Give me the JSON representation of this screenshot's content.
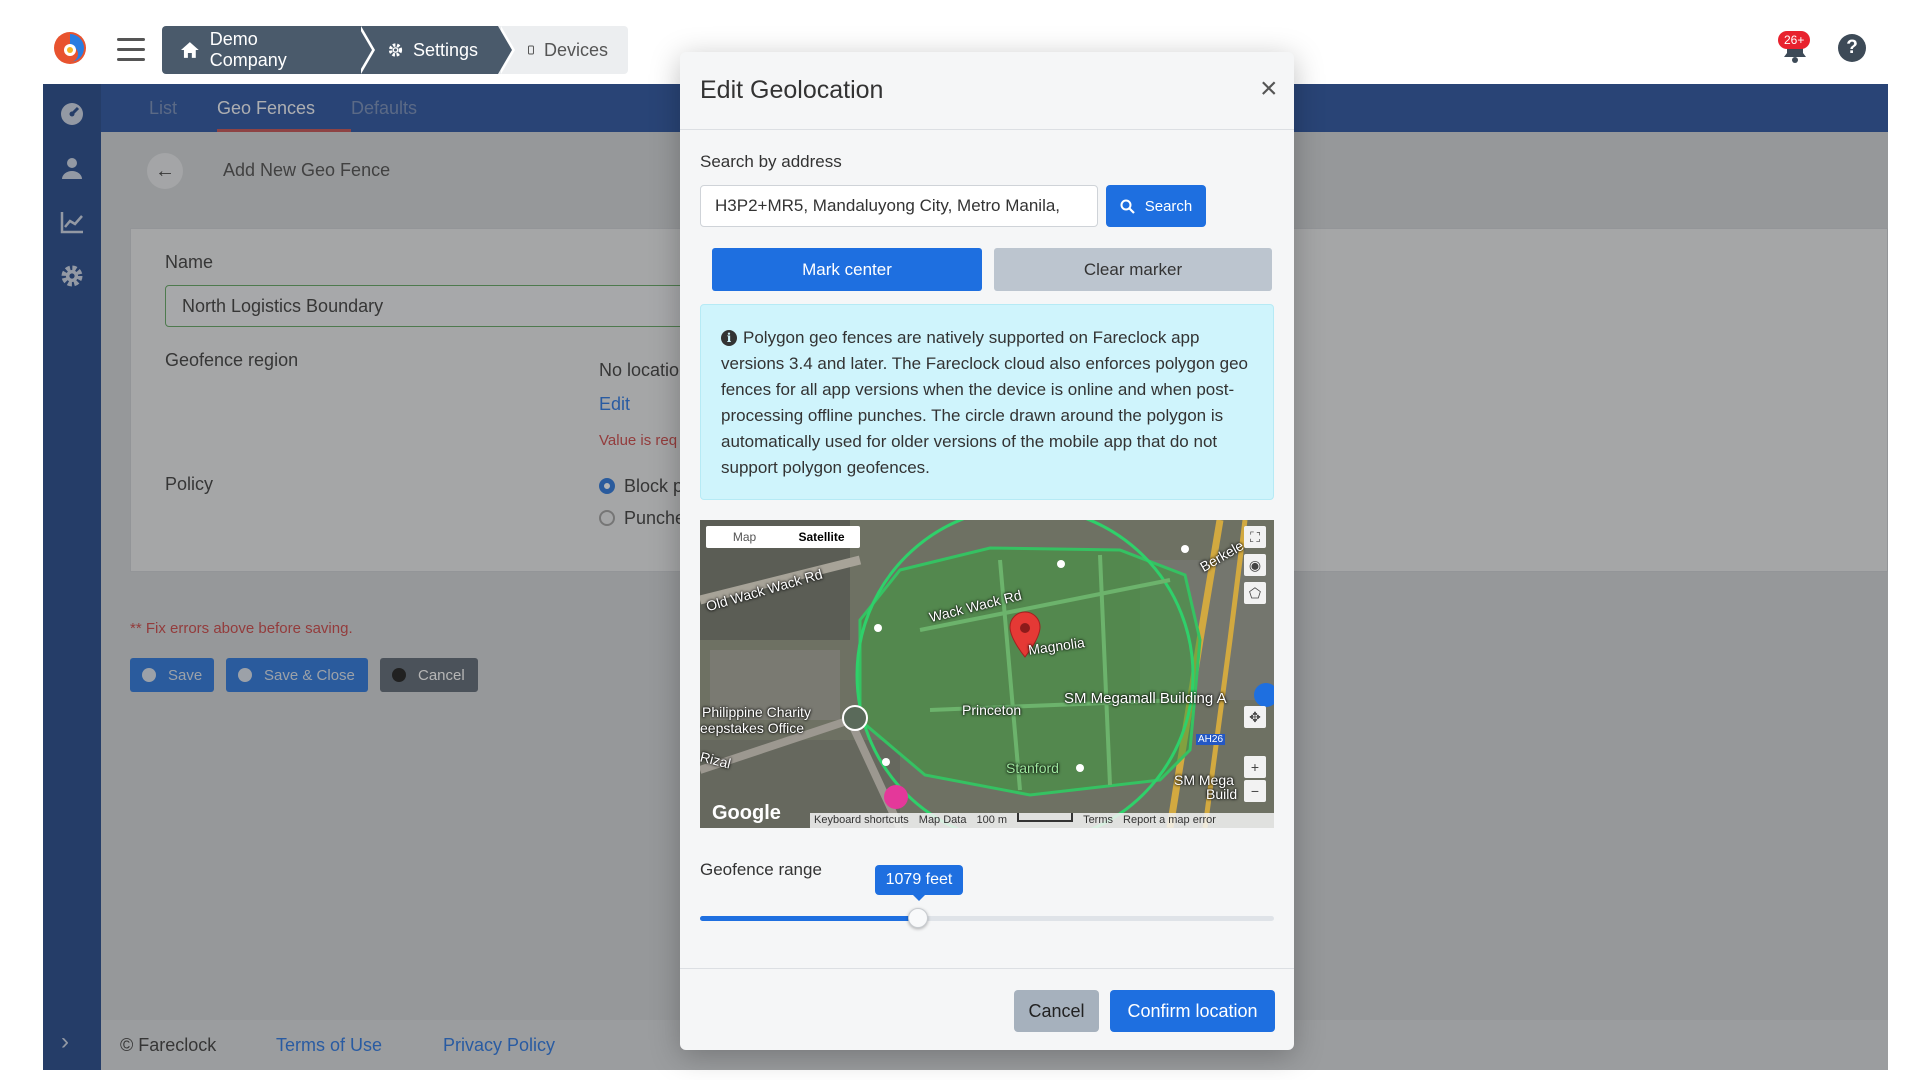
{
  "header": {
    "breadcrumbs": [
      "Demo Company",
      "Settings",
      "Devices"
    ],
    "notification_count": "26+",
    "help_label": "?"
  },
  "nav": {
    "tabs": [
      "List",
      "Geo Fences",
      "Defaults"
    ],
    "active_tab": "Geo Fences"
  },
  "page": {
    "title": "Add New Geo Fence",
    "name_label": "Name",
    "name_value": "North Logistics Boundary",
    "region_label": "Geofence region",
    "region_value": "No locatio",
    "region_edit": "Edit",
    "region_error": "Value is req",
    "policy_label": "Policy",
    "policy_options": [
      "Block p",
      "Punche"
    ],
    "form_error": "** Fix errors above before saving.",
    "save_label": "Save",
    "save_close_label": "Save & Close",
    "cancel_label": "Cancel"
  },
  "footer": {
    "copyright": "© Fareclock",
    "terms": "Terms of Use",
    "privacy": "Privacy Policy"
  },
  "modal": {
    "title": "Edit Geolocation",
    "close_label": "×",
    "search_label": "Search by address",
    "search_value": "H3P2+MR5, Mandaluyong City, Metro Manila,",
    "search_button": "Search",
    "mark_center": "Mark center",
    "clear_marker": "Clear marker",
    "info_text": "Polygon geo fences are natively supported on Fareclock app versions 3.4 and later. The Fareclock cloud also enforces polygon geo fences for all app versions when the device is online and when post-processing offline punches. The circle drawn around the polygon is automatically used for older versions of the mobile app that do not support polygon geofences.",
    "map": {
      "toggle": [
        "Map",
        "Satellite"
      ],
      "selected_toggle": "Satellite",
      "labels": [
        "Old Wack Wack Rd",
        "Wack Wack Rd",
        "Magnolia",
        "Princeton",
        "SM Megamall Building A",
        "Philippine Charity",
        "eepstakes Office",
        "Rizal",
        "Stanford",
        "Berkele",
        "SM Mega",
        "Build",
        "AH26"
      ],
      "attribution": [
        "Keyboard shortcuts",
        "Map Data",
        "100 m",
        "Terms",
        "Report a map error"
      ],
      "logo": "Google"
    },
    "range_label": "Geofence range",
    "range_value": "1079 feet",
    "range_fraction": 0.38,
    "cancel": "Cancel",
    "confirm": "Confirm location"
  },
  "colors": {
    "primary": "#1e6fe0",
    "nav_bg": "#1d4a9a",
    "sidebar_bg": "#173e83",
    "info_bg": "#cff4fc",
    "error": "#c83c3c",
    "badge": "#e8222e"
  }
}
